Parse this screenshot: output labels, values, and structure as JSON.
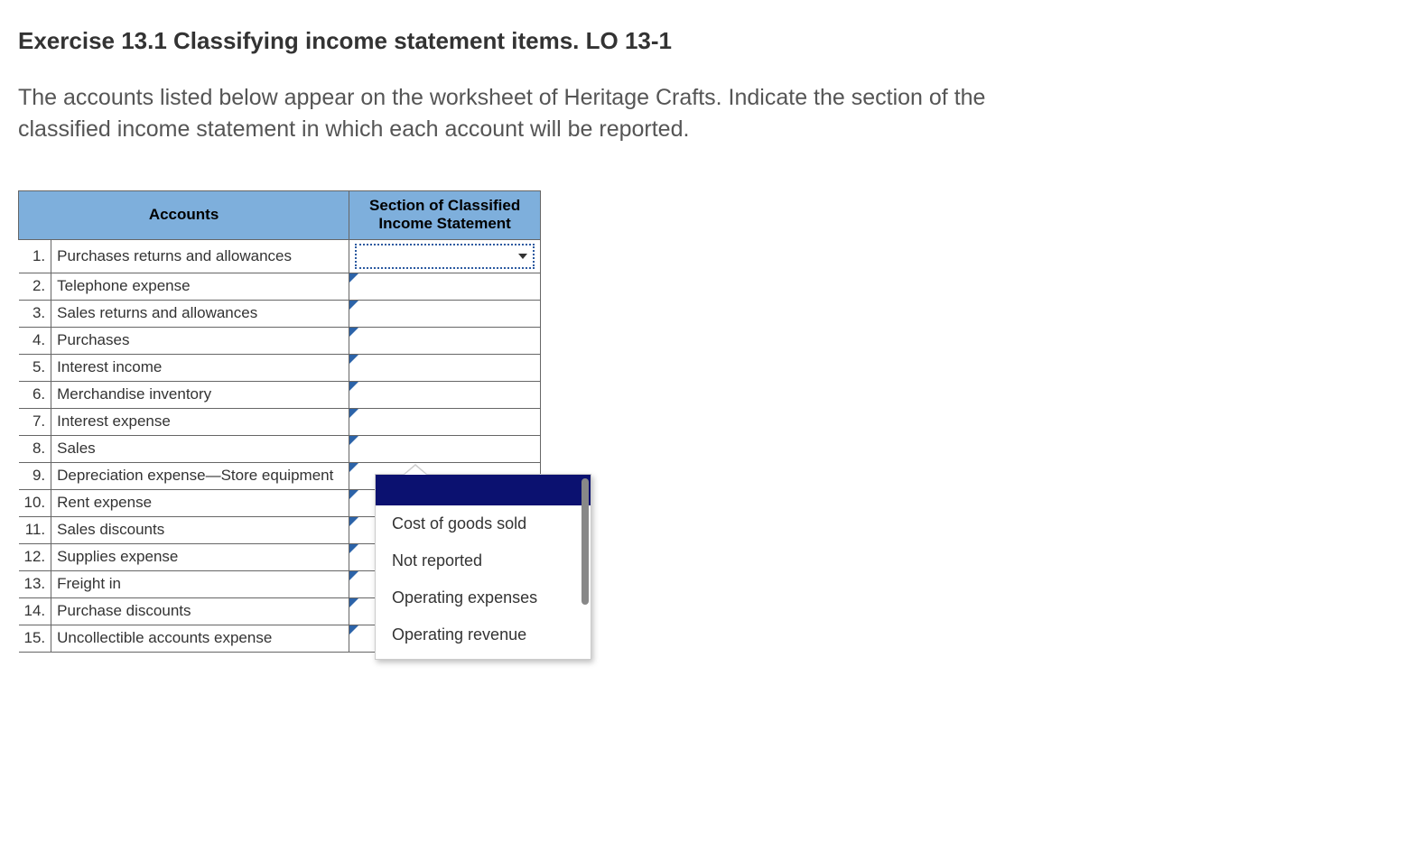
{
  "title": "Exercise 13.1 Classifying income statement items. LO 13-1",
  "instructions": "The accounts listed below appear on the worksheet of Heritage Crafts. Indicate the section of the classified income statement in which each account will be reported.",
  "headers": {
    "accounts": "Accounts",
    "section": "Section of Classified Income Statement"
  },
  "rows": [
    {
      "num": "1.",
      "account": "Purchases returns and allowances"
    },
    {
      "num": "2.",
      "account": "Telephone expense"
    },
    {
      "num": "3.",
      "account": "Sales returns and allowances"
    },
    {
      "num": "4.",
      "account": "Purchases"
    },
    {
      "num": "5.",
      "account": "Interest income"
    },
    {
      "num": "6.",
      "account": "Merchandise inventory"
    },
    {
      "num": "7.",
      "account": "Interest expense"
    },
    {
      "num": "8.",
      "account": "Sales"
    },
    {
      "num": "9.",
      "account": "Depreciation expense—Store equipment"
    },
    {
      "num": "10.",
      "account": "Rent expense"
    },
    {
      "num": "11.",
      "account": "Sales discounts"
    },
    {
      "num": "12.",
      "account": "Supplies expense"
    },
    {
      "num": "13.",
      "account": "Freight in"
    },
    {
      "num": "14.",
      "account": "Purchase discounts"
    },
    {
      "num": "15.",
      "account": "Uncollectible accounts expense"
    }
  ],
  "dropdown": {
    "selected": "",
    "options": [
      "",
      "Cost of goods sold",
      "Not reported",
      "Operating expenses",
      "Operating revenue"
    ]
  }
}
